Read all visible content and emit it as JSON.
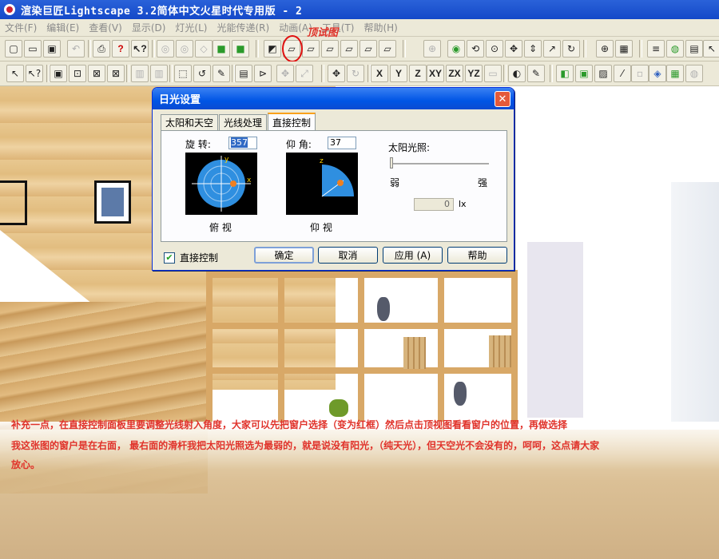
{
  "app": {
    "title": "渲染巨匠Lightscape 3.2简体中文火星时代专用版 - 2"
  },
  "menu": [
    "文件(F)",
    "编辑(E)",
    "查看(V)",
    "显示(D)",
    "灯光(L)",
    "光能传递(R)",
    "动画(A)",
    "工具(T)",
    "帮助(H)"
  ],
  "annotation_top": "顶试图",
  "toolbar2_axes": [
    "X",
    "Y",
    "Z",
    "XY",
    "ZX",
    "YZ"
  ],
  "dialog": {
    "title": "日光设置",
    "close": "✕",
    "tabs": [
      "太阳和天空",
      "光线处理",
      "直接控制"
    ],
    "rotate_label": "旋 转:",
    "rotate_value": "357",
    "elevation_label": "仰 角:",
    "elevation_value": "37",
    "top_view_label": "俯 视",
    "elevation_view_label": "仰 视",
    "top_axis_y": "y",
    "top_axis_x": "x",
    "elev_axis_z": "z",
    "sun_label": "太阳光照:",
    "weak": "弱",
    "strong": "强",
    "lux_value": "0",
    "lux_unit": "lx",
    "direct_control_label": "直接控制",
    "direct_control_checked": true,
    "buttons": {
      "ok": "确定",
      "cancel": "取消",
      "apply": "应用 (A)",
      "help": "帮助"
    }
  },
  "notes": [
    "补充一点，在直接控制面板里要调整光线射入角度，大家可以先把窗户选择（变为红框）然后点击顶视图看看窗户的位置，再做选择",
    "我这张图的窗户是在右面，    最右面的滑杆我把太阳光照选为最弱的，就是说没有阳光，（纯天光），但天空光不会没有的，呵呵，这点请大家",
    "放心。"
  ],
  "colors": {
    "note": "#e0322a",
    "sun": "#f08020",
    "globe": "#2f8fe0"
  }
}
